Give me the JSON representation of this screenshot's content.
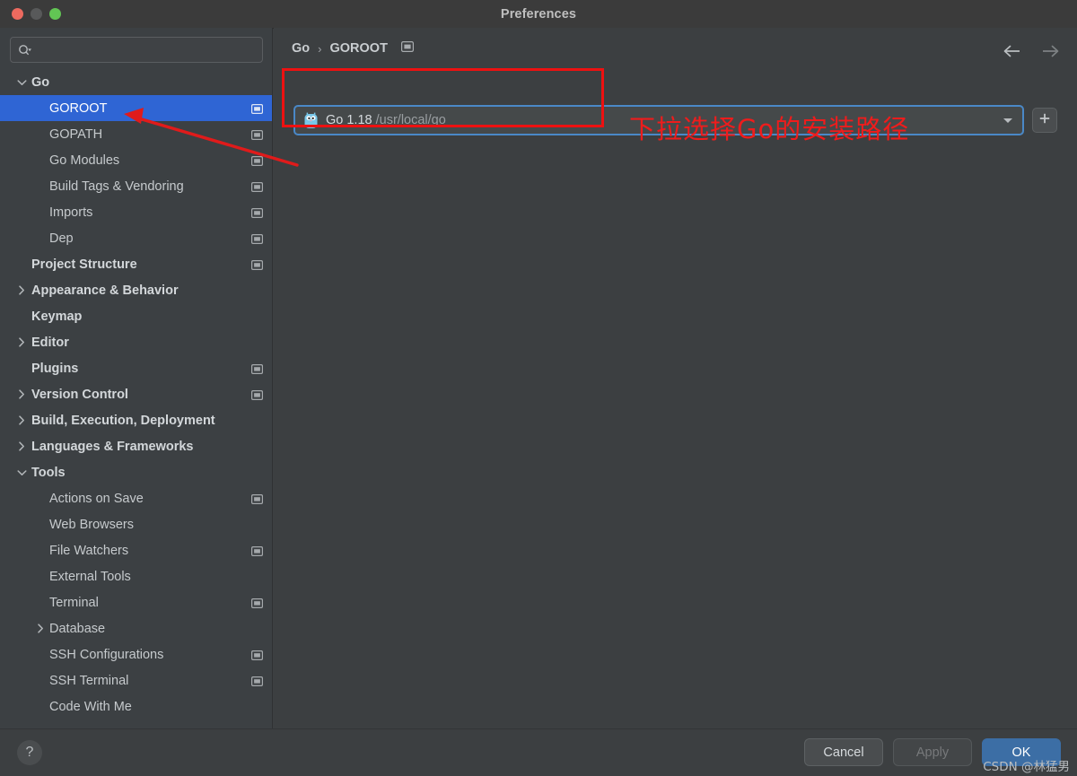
{
  "window": {
    "title": "Preferences",
    "traffic_lights": [
      "close",
      "minimize",
      "zoom"
    ]
  },
  "sidebar": {
    "search": {
      "placeholder": "",
      "value": "",
      "icon": "search-icon"
    },
    "items": [
      {
        "label": "Go",
        "level": 0,
        "bold": true,
        "twisty": "down",
        "badge": false,
        "selected": false
      },
      {
        "label": "GOROOT",
        "level": 1,
        "bold": false,
        "twisty": "none",
        "badge": true,
        "selected": true
      },
      {
        "label": "GOPATH",
        "level": 1,
        "bold": false,
        "twisty": "none",
        "badge": true,
        "selected": false
      },
      {
        "label": "Go Modules",
        "level": 1,
        "bold": false,
        "twisty": "none",
        "badge": true,
        "selected": false
      },
      {
        "label": "Build Tags & Vendoring",
        "level": 1,
        "bold": false,
        "twisty": "none",
        "badge": true,
        "selected": false
      },
      {
        "label": "Imports",
        "level": 1,
        "bold": false,
        "twisty": "none",
        "badge": true,
        "selected": false
      },
      {
        "label": "Dep",
        "level": 1,
        "bold": false,
        "twisty": "none",
        "badge": true,
        "selected": false
      },
      {
        "label": "Project Structure",
        "level": 0,
        "bold": true,
        "twisty": "none",
        "badge": true,
        "selected": false
      },
      {
        "label": "Appearance & Behavior",
        "level": 0,
        "bold": true,
        "twisty": "right",
        "badge": false,
        "selected": false
      },
      {
        "label": "Keymap",
        "level": 0,
        "bold": true,
        "twisty": "none",
        "badge": false,
        "selected": false
      },
      {
        "label": "Editor",
        "level": 0,
        "bold": true,
        "twisty": "right",
        "badge": false,
        "selected": false
      },
      {
        "label": "Plugins",
        "level": 0,
        "bold": true,
        "twisty": "none",
        "badge": true,
        "selected": false
      },
      {
        "label": "Version Control",
        "level": 0,
        "bold": true,
        "twisty": "right",
        "badge": true,
        "selected": false
      },
      {
        "label": "Build, Execution, Deployment",
        "level": 0,
        "bold": true,
        "twisty": "right",
        "badge": false,
        "selected": false
      },
      {
        "label": "Languages & Frameworks",
        "level": 0,
        "bold": true,
        "twisty": "right",
        "badge": false,
        "selected": false
      },
      {
        "label": "Tools",
        "level": 0,
        "bold": true,
        "twisty": "down",
        "badge": false,
        "selected": false
      },
      {
        "label": "Actions on Save",
        "level": 1,
        "bold": false,
        "twisty": "none",
        "badge": true,
        "selected": false
      },
      {
        "label": "Web Browsers",
        "level": 1,
        "bold": false,
        "twisty": "none",
        "badge": false,
        "selected": false
      },
      {
        "label": "File Watchers",
        "level": 1,
        "bold": false,
        "twisty": "none",
        "badge": true,
        "selected": false
      },
      {
        "label": "External Tools",
        "level": 1,
        "bold": false,
        "twisty": "none",
        "badge": false,
        "selected": false
      },
      {
        "label": "Terminal",
        "level": 1,
        "bold": false,
        "twisty": "none",
        "badge": true,
        "selected": false
      },
      {
        "label": "Database",
        "level": 1,
        "bold": false,
        "twisty": "right",
        "badge": false,
        "selected": false
      },
      {
        "label": "SSH Configurations",
        "level": 1,
        "bold": false,
        "twisty": "none",
        "badge": true,
        "selected": false
      },
      {
        "label": "SSH Terminal",
        "level": 1,
        "bold": false,
        "twisty": "none",
        "badge": true,
        "selected": false
      },
      {
        "label": "Code With Me",
        "level": 1,
        "bold": false,
        "twisty": "none",
        "badge": false,
        "selected": false
      }
    ]
  },
  "content": {
    "breadcrumb": {
      "root": "Go",
      "separator": "›",
      "leaf": "GOROOT",
      "icon": "project-scope-icon"
    },
    "nav": {
      "back_icon": "arrow-left-icon",
      "forward_icon": "arrow-right-icon"
    },
    "goroot": {
      "icon": "gopher-icon",
      "version": "Go 1.18",
      "path": "/usr/local/go",
      "dropdown_icon": "chevron-down-icon",
      "add_button_icon": "plus-icon"
    }
  },
  "annotations": {
    "chinese_note": "下拉选择Go的安装路径",
    "highlight_color": "#ee1111",
    "arrow_color": "#e01b1b"
  },
  "footer": {
    "help_label": "?",
    "cancel_label": "Cancel",
    "apply_label": "Apply",
    "ok_label": "OK",
    "watermark": "CSDN @林猛男"
  },
  "colors": {
    "accent_selection": "#2f65d4",
    "primary_button": "#3c6ea5",
    "focus_border": "#4a88c7",
    "sidebar_bg": "#3c4043",
    "content_bg": "#3c3f41"
  }
}
